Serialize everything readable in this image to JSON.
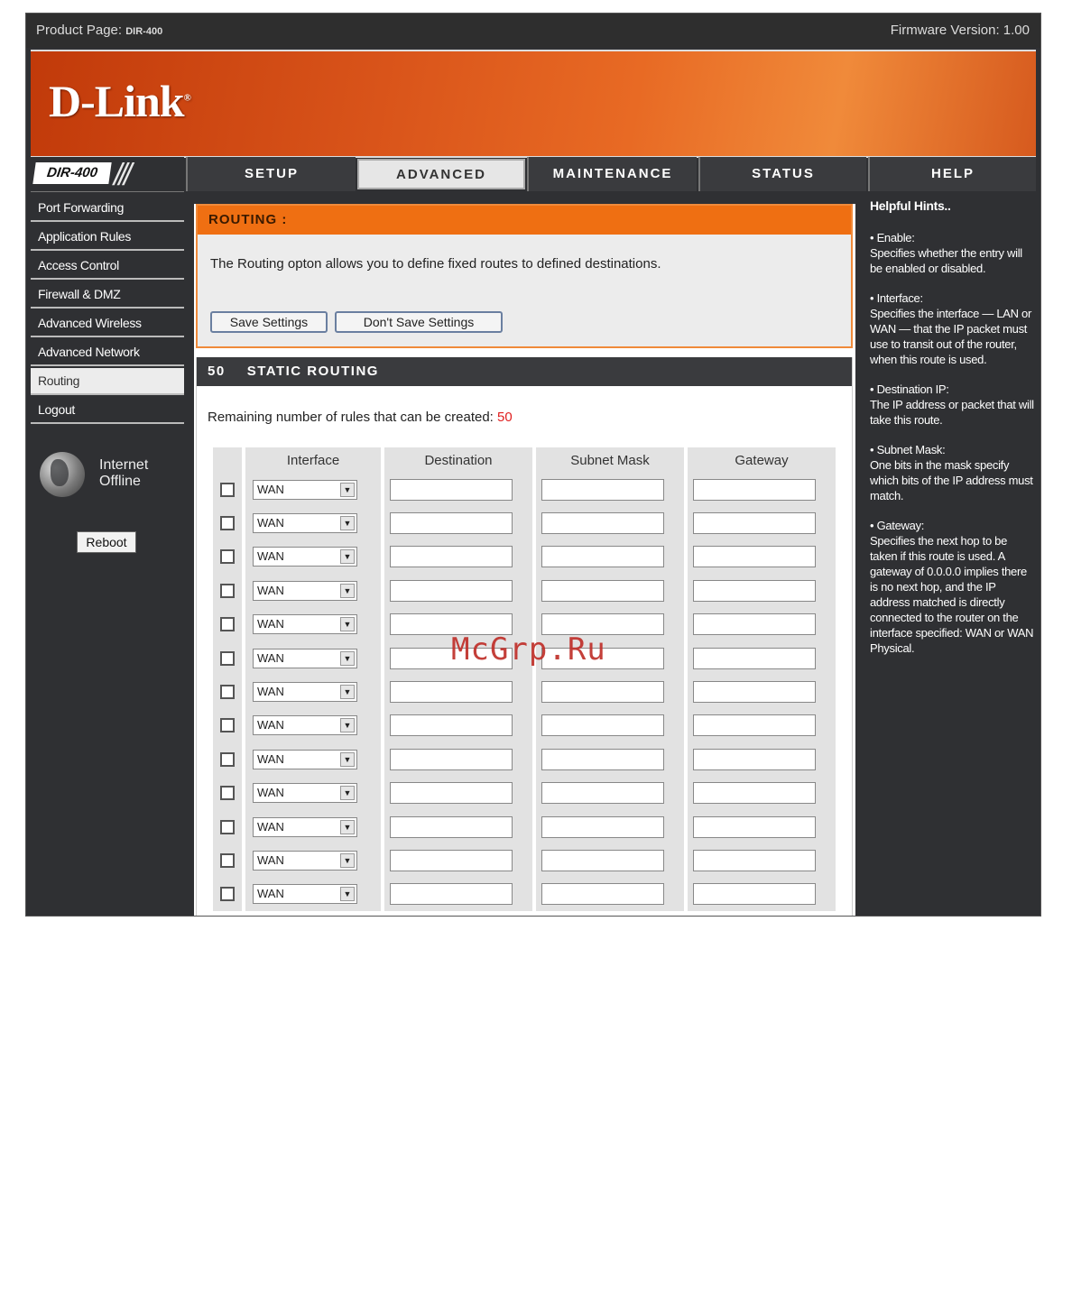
{
  "topbar": {
    "product_label": "Product Page:",
    "product_model": "DIR-400",
    "firmware": "Firmware Version: 1.00"
  },
  "brand": {
    "logo_text": "D-Link",
    "logo_mark": "®",
    "model_tag": "DIR-400",
    "model_slashes": "///"
  },
  "tabs": [
    {
      "label": "SETUP"
    },
    {
      "label": "ADVANCED"
    },
    {
      "label": "MAINTENANCE"
    },
    {
      "label": "STATUS"
    },
    {
      "label": "HELP"
    }
  ],
  "sidebar": {
    "items": [
      {
        "label": "Port Forwarding"
      },
      {
        "label": "Application Rules"
      },
      {
        "label": "Access Control"
      },
      {
        "label": "Firewall & DMZ"
      },
      {
        "label": "Advanced Wireless"
      },
      {
        "label": "Advanced Network"
      },
      {
        "label": "Routing"
      },
      {
        "label": "Logout"
      }
    ],
    "internet_line1": "Internet",
    "internet_line2": "Offline",
    "reboot_label": "Reboot"
  },
  "routing": {
    "title": "ROUTING :",
    "description": "The Routing opton allows you to define fixed routes to defined destinations.",
    "save_label": "Save Settings",
    "dont_save_label": "Don't Save Settings"
  },
  "static_routing": {
    "count": "50",
    "title": "STATIC ROUTING",
    "remaining_label": "Remaining number of rules that can be created:",
    "remaining_value": "50",
    "columns": {
      "interface": "Interface",
      "destination": "Destination",
      "subnet_mask": "Subnet Mask",
      "gateway": "Gateway"
    },
    "row_interface_value": "WAN"
  },
  "help": {
    "title": "Helpful Hints..",
    "hints": [
      {
        "name": "• Enable:",
        "text": "Specifies whether the entry will be enabled or disabled."
      },
      {
        "name": "• Interface:",
        "text": "Specifies the interface — LAN or WAN — that the IP packet must use to transit out of the router, when this route is used."
      },
      {
        "name": "• Destination IP:",
        "text": "The IP address or packet that will take this route."
      },
      {
        "name": "• Subnet Mask:",
        "text": "One bits in the mask specify which bits of the IP address must match."
      },
      {
        "name": "• Gateway:",
        "text": "Specifies the next hop to be taken if this route is used. A gateway of 0.0.0.0 implies there is no next hop, and the IP address matched is directly connected to the router on the interface specified: WAN or WAN Physical."
      }
    ]
  },
  "watermark": "McGrp.Ru",
  "colors": {
    "accent_orange": "#ef6f12",
    "frame_dark": "#2f3033",
    "remaining_red": "#e02020"
  }
}
